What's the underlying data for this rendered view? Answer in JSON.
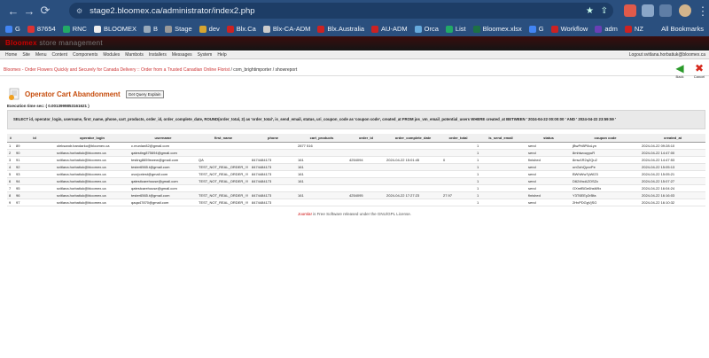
{
  "browser": {
    "url": "stage2.bloomex.ca/administrator/index2.php",
    "bookmarks": [
      {
        "label": "G",
        "color": "#4285f4"
      },
      {
        "label": "87654",
        "color": "#d33"
      },
      {
        "label": "RNC",
        "color": "#2a6"
      },
      {
        "label": "BLOOMEX",
        "color": "#eee"
      },
      {
        "label": "B",
        "color": "#9ab"
      },
      {
        "label": "Stage",
        "color": "#999"
      },
      {
        "label": "dev",
        "color": "#d6a530"
      },
      {
        "label": "Blx.Ca",
        "color": "#c22"
      },
      {
        "label": "Blx-CA-ADM",
        "color": "#ccc"
      },
      {
        "label": "Blx.Australia",
        "color": "#c22"
      },
      {
        "label": "AU-ADM",
        "color": "#c22"
      },
      {
        "label": "Orca",
        "color": "#6ad"
      },
      {
        "label": "List",
        "color": "#2a6"
      },
      {
        "label": "Bloomex.xlsx",
        "color": "#1d7145"
      },
      {
        "label": "G",
        "color": "#4285f4"
      },
      {
        "label": "Workflow",
        "color": "#c22"
      },
      {
        "label": "adm",
        "color": "#6a3fb5"
      },
      {
        "label": "NZ",
        "color": "#c22"
      }
    ],
    "all_bookmarks": "All Bookmarks"
  },
  "admin": {
    "brand": "Bloomex",
    "brand_sub": "store management",
    "menu": [
      "Home",
      "Site",
      "Menu",
      "Content",
      "Components",
      "Modules",
      "Mambots",
      "Installers",
      "Messages",
      "System",
      "Help"
    ],
    "logout": "Logout svitlana.horbatiuk@bloomex.ca",
    "path": "Bloomex - Order Flowers Quickly and Securely for Canada Delivery :: Order from a Trusted Canadian Online Florist",
    "path_tail": " / com_brightimporter / showreport",
    "back_label": "Back",
    "cancel_label": "Cancel"
  },
  "page": {
    "title": "Operator Cart Abandonment",
    "query_button": "Get Query Explain",
    "exec_time": "Execution time sec: ( 0.0013999853161621 )",
    "sql": "SELECT id, operator_login, username, first_name, phone, cart_products, order_id, order_complete_date, ROUND(order_total, 2) as 'order_total', is_send_email, status, uri_coupon_code as 'coupon code', created_at FROM jos_vm_email_potential_users WHERE created_at BETWEEN ' 2024-04-22 00:00:00 ' AND ' 2024-04-22 23:59:59 '"
  },
  "table": {
    "columns": [
      "#",
      "id",
      "operator_login",
      "username",
      "first_name",
      "phone",
      "cart_products",
      "order_id",
      "order_complete_date",
      "order_total",
      "is_send_email",
      "status",
      "coupon code",
      "created_at"
    ],
    "rows": [
      [
        "1",
        "89",
        "oleksandr.bandarko@bloomex.ca",
        "c.munlan82@gmail.com",
        "",
        "",
        "2877 516",
        "",
        "",
        "",
        "1",
        "send",
        "jBwPrl8P8oLyn",
        "2024-04-22 09:28:10"
      ],
      [
        "2",
        "90",
        "svitlana.horbatiuk@bloomex.ca",
        "qatesting875694@gmail.com",
        "",
        "",
        "",
        "",
        "",
        "",
        "1",
        "send",
        "8mhiwouyyuR",
        "2024-04-22 14:47:00"
      ],
      [
        "3",
        "91",
        "svitlana.horbatiuk@bloomex.ca",
        "testing8659ewew@gmail.com",
        "QA",
        "8474484173",
        "161",
        "4254094",
        "2024-04-22 15:01:45",
        "0",
        "1",
        "finished",
        "8mw1R2q2Qu2",
        "2024-04-22 14:47:53"
      ],
      [
        "4",
        "92",
        "svitlana.horbatiuk@bloomex.ca",
        "tester6565.t@gmail.com",
        "TEST_NOT_REAL_ORDER_!!!",
        "8474484173",
        "161",
        "",
        "",
        "",
        "1",
        "send",
        "unGzhQyvvPe",
        "2024-04-22 15:05:13"
      ],
      [
        "5",
        "93",
        "svitlana.horbatiuk@bloomex.ca",
        "ovcrjcxtest@gmail.com",
        "TEST_NOT_REAL_ORDER_!!!",
        "8474484173",
        "161",
        "",
        "",
        "",
        "1",
        "send",
        "BWhWw7yWi23",
        "2024-04-22 15:05:21"
      ],
      [
        "6",
        "94",
        "svitlana.horbatiuk@bloomex.ca",
        "qatesticarehouse@gmail.com",
        "TEST_NOT_REAL_ORDER_!!!",
        "8474484173",
        "161",
        "",
        "",
        "",
        "1",
        "send",
        "D624hcAZOSZc",
        "2024-04-22 15:07:27"
      ],
      [
        "7",
        "95",
        "svitlana.horbatiuk@bloomex.ca",
        "qatestcarehouse@gmail.com",
        "",
        "",
        "",
        "",
        "",
        "",
        "1",
        "send",
        "GXmfBGe6hsM9x",
        "2024-04-22 16:04:24"
      ],
      [
        "8",
        "96",
        "svitlana.horbatiuk@bloomex.ca",
        "tester6565.t@gmail.com",
        "TEST_NOT_REAL_ORDER_!!!",
        "8474484173",
        "161",
        "4254095",
        "2024-04-22 17:27:23",
        "27.97",
        "1",
        "finished",
        "Y3T6EEy2rBfa",
        "2024-04-22 16:16:03"
      ],
      [
        "9",
        "97",
        "svitlana.horbatiuk@bloomex.ca",
        "qaqa47870@gmail.com",
        "TEST_NOT_REAL_ORDER_!!!",
        "8474484173",
        "",
        "",
        "",
        "",
        "1",
        "send",
        "2HvPDGgVjSG",
        "2024-04-22 16:10:32"
      ]
    ]
  },
  "footer": {
    "link": "Joomla!",
    "text": " is Free Software released under the GNU/GPL License."
  }
}
